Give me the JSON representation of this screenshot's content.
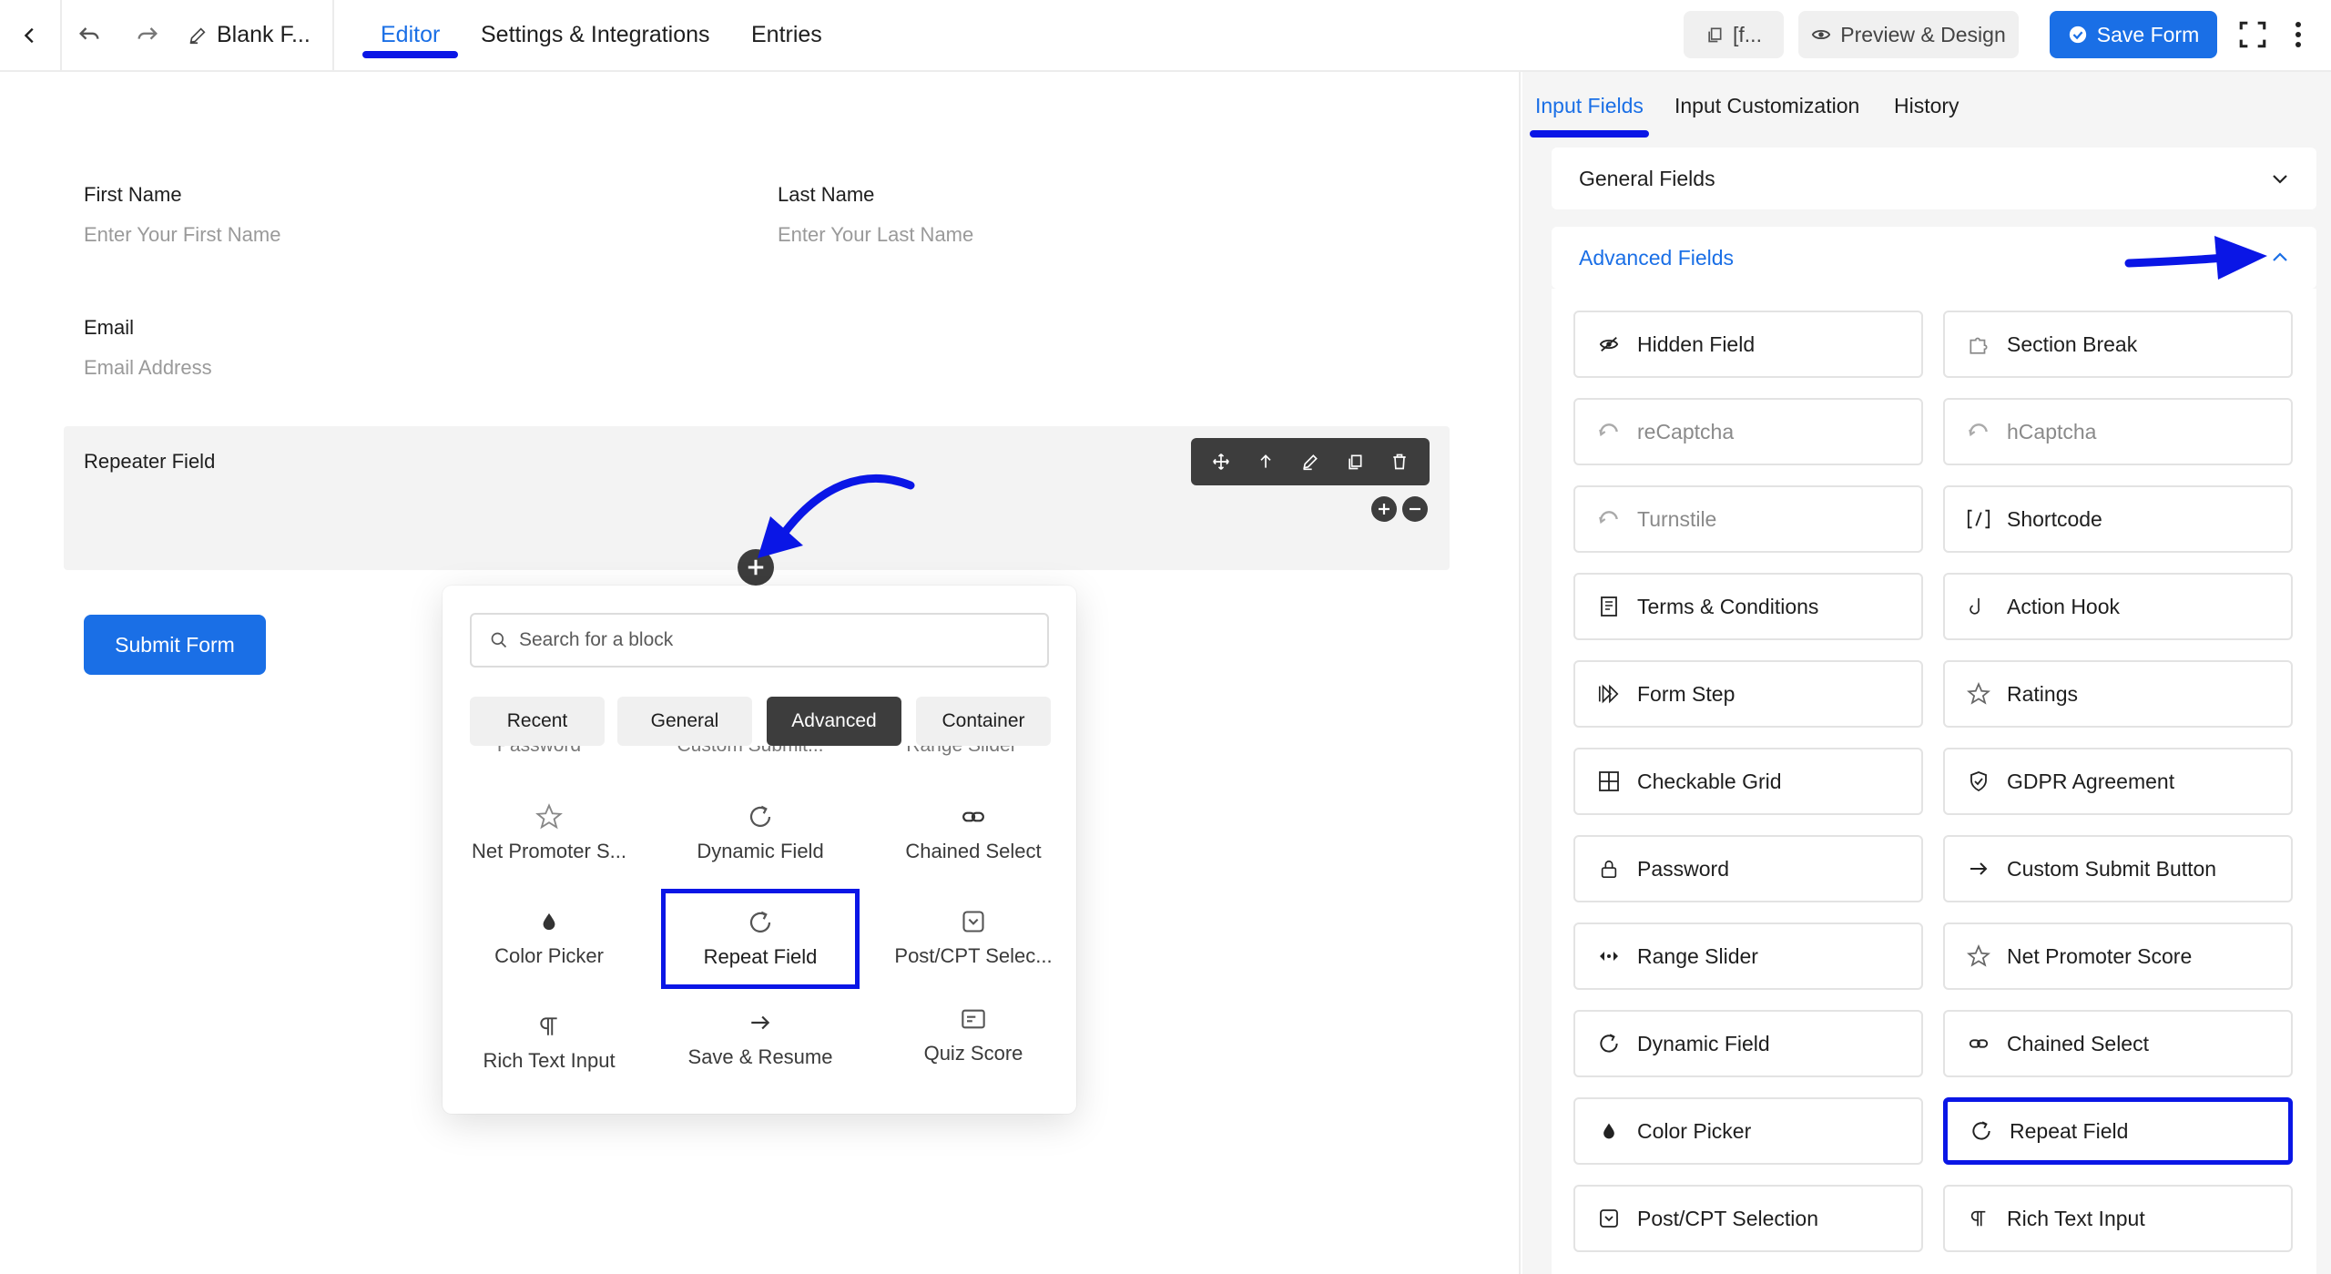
{
  "topbar": {
    "form_title": "Blank F...",
    "tabs": [
      {
        "label": "Editor",
        "active": true
      },
      {
        "label": "Settings & Integrations",
        "active": false
      },
      {
        "label": "Entries",
        "active": false
      }
    ],
    "shortcode_label": "[f...",
    "preview_label": "Preview & Design",
    "save_label": "Save Form"
  },
  "form": {
    "first_name": {
      "label": "First Name",
      "placeholder": "Enter Your First Name"
    },
    "last_name": {
      "label": "Last Name",
      "placeholder": "Enter Your Last Name"
    },
    "email": {
      "label": "Email",
      "placeholder": "Email Address"
    },
    "repeater": {
      "label": "Repeater Field"
    },
    "submit_label": "Submit Form"
  },
  "inserter": {
    "search_placeholder": "Search for a block",
    "tabs": [
      {
        "label": "Recent",
        "active": false
      },
      {
        "label": "General",
        "active": false
      },
      {
        "label": "Advanced",
        "active": true
      },
      {
        "label": "Container",
        "active": false
      }
    ],
    "peek_labels": [
      "Password",
      "Custom Submit...",
      "Range Slider"
    ],
    "blocks": [
      {
        "label": "Net Promoter S...",
        "icon": "star-icon"
      },
      {
        "label": "Dynamic Field",
        "icon": "refresh-icon"
      },
      {
        "label": "Chained Select",
        "icon": "link-icon"
      },
      {
        "label": "Color Picker",
        "icon": "drop-icon"
      },
      {
        "label": "Repeat Field",
        "icon": "refresh-icon",
        "selected": true
      },
      {
        "label": "Post/CPT Selec...",
        "icon": "post-select-icon"
      },
      {
        "label": "Rich Text Input",
        "icon": "paragraph-icon"
      },
      {
        "label": "Save & Resume",
        "icon": "arrow-right-icon"
      },
      {
        "label": "Quiz Score",
        "icon": "quiz-icon"
      }
    ]
  },
  "panel": {
    "tabs": [
      {
        "label": "Input Fields",
        "active": true
      },
      {
        "label": "Input Customization",
        "active": false
      },
      {
        "label": "History",
        "active": false
      }
    ],
    "general_fields_label": "General Fields",
    "advanced_fields_label": "Advanced Fields",
    "fields": [
      {
        "label": "Hidden Field",
        "icon": "eye-slash-icon"
      },
      {
        "label": "Section Break",
        "icon": "puzzle-icon"
      },
      {
        "label": "reCaptcha",
        "icon": "recaptcha-icon",
        "disabled": true
      },
      {
        "label": "hCaptcha",
        "icon": "recaptcha-icon",
        "disabled": true
      },
      {
        "label": "Turnstile",
        "icon": "recaptcha-icon",
        "disabled": true
      },
      {
        "label": "Shortcode",
        "icon": "shortcode-icon"
      },
      {
        "label": "Terms & Conditions",
        "icon": "document-icon"
      },
      {
        "label": "Action Hook",
        "icon": "hook-icon"
      },
      {
        "label": "Form Step",
        "icon": "step-icon"
      },
      {
        "label": "Ratings",
        "icon": "star-icon"
      },
      {
        "label": "Checkable Grid",
        "icon": "grid-icon"
      },
      {
        "label": "GDPR Agreement",
        "icon": "shield-icon"
      },
      {
        "label": "Password",
        "icon": "lock-icon"
      },
      {
        "label": "Custom Submit Button",
        "icon": "arrow-right-icon"
      },
      {
        "label": "Range Slider",
        "icon": "range-icon"
      },
      {
        "label": "Net Promoter Score",
        "icon": "star-icon"
      },
      {
        "label": "Dynamic Field",
        "icon": "refresh-icon"
      },
      {
        "label": "Chained Select",
        "icon": "link-icon"
      },
      {
        "label": "Color Picker",
        "icon": "drop-icon"
      },
      {
        "label": "Repeat Field",
        "icon": "refresh-icon",
        "selected": true
      },
      {
        "label": "Post/CPT Selection",
        "icon": "post-select-icon"
      },
      {
        "label": "Rich Text Input",
        "icon": "paragraph-icon"
      }
    ]
  },
  "colors": {
    "accent": "#1a6fe6",
    "annotation": "#0a16e6",
    "toolbar_dark": "#3d3d3d"
  }
}
